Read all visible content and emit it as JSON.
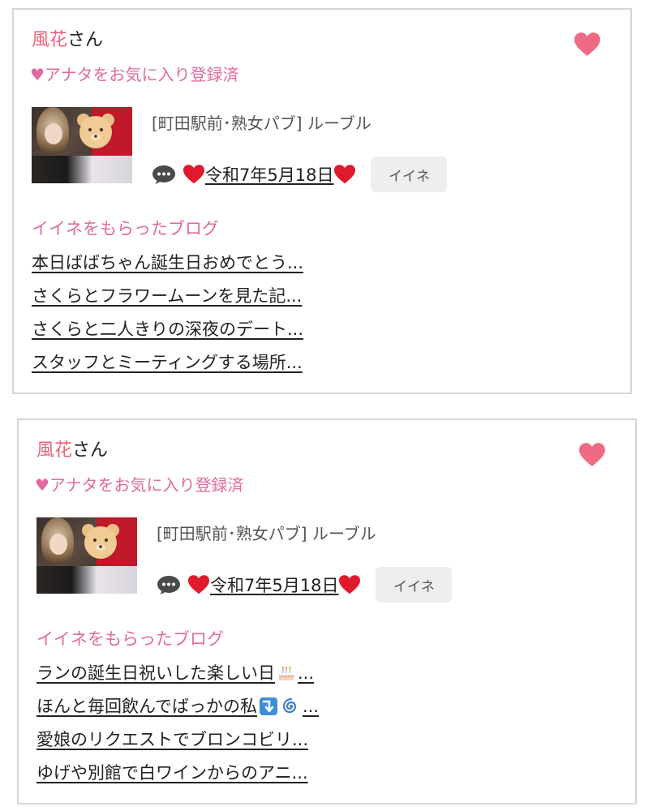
{
  "accent_pink": "#e06a9f",
  "heart_color": "#ee6b83",
  "cards": [
    {
      "name": "風花",
      "honorific": "さん",
      "favorite_status": "♥アナタをお気に入り登録済",
      "shop": "[町田駅前･熟女パブ]  ルーブル",
      "post_title": "令和7年5月18日",
      "iine_label": "イイネ",
      "blog_heading": "イイネをもらったブログ",
      "blogs": [
        {
          "before": "本日ばばちゃん誕生日おめでとう",
          "emoji": "",
          "after": "..."
        },
        {
          "before": "さくらとフラワームーンを見た記",
          "emoji": "",
          "after": "..."
        },
        {
          "before": "さくらと二人きりの深夜のデート",
          "emoji": "",
          "after": "..."
        },
        {
          "before": "スタッフとミーティングする場所",
          "emoji": "",
          "after": "..."
        }
      ]
    },
    {
      "name": "風花",
      "honorific": "さん",
      "favorite_status": "♥アナタをお気に入り登録済",
      "shop": "[町田駅前･熟女パブ]  ルーブル",
      "post_title": "令和7年5月18日",
      "iine_label": "イイネ",
      "blog_heading": "イイネをもらったブログ",
      "blogs": [
        {
          "before": "ランの誕生日祝いした楽しい日",
          "emoji": "cake-icon",
          "after": "..."
        },
        {
          "before": "ほんと毎回飲んでばっかの私",
          "emoji": "arrow-down-right-icon cyclone-icon",
          "after": "..."
        },
        {
          "before": "愛娘のリクエストでブロンコビリ",
          "emoji": "",
          "after": "..."
        },
        {
          "before": "ゆげや別館で白ワインからのアニ",
          "emoji": "",
          "after": "..."
        }
      ]
    }
  ]
}
